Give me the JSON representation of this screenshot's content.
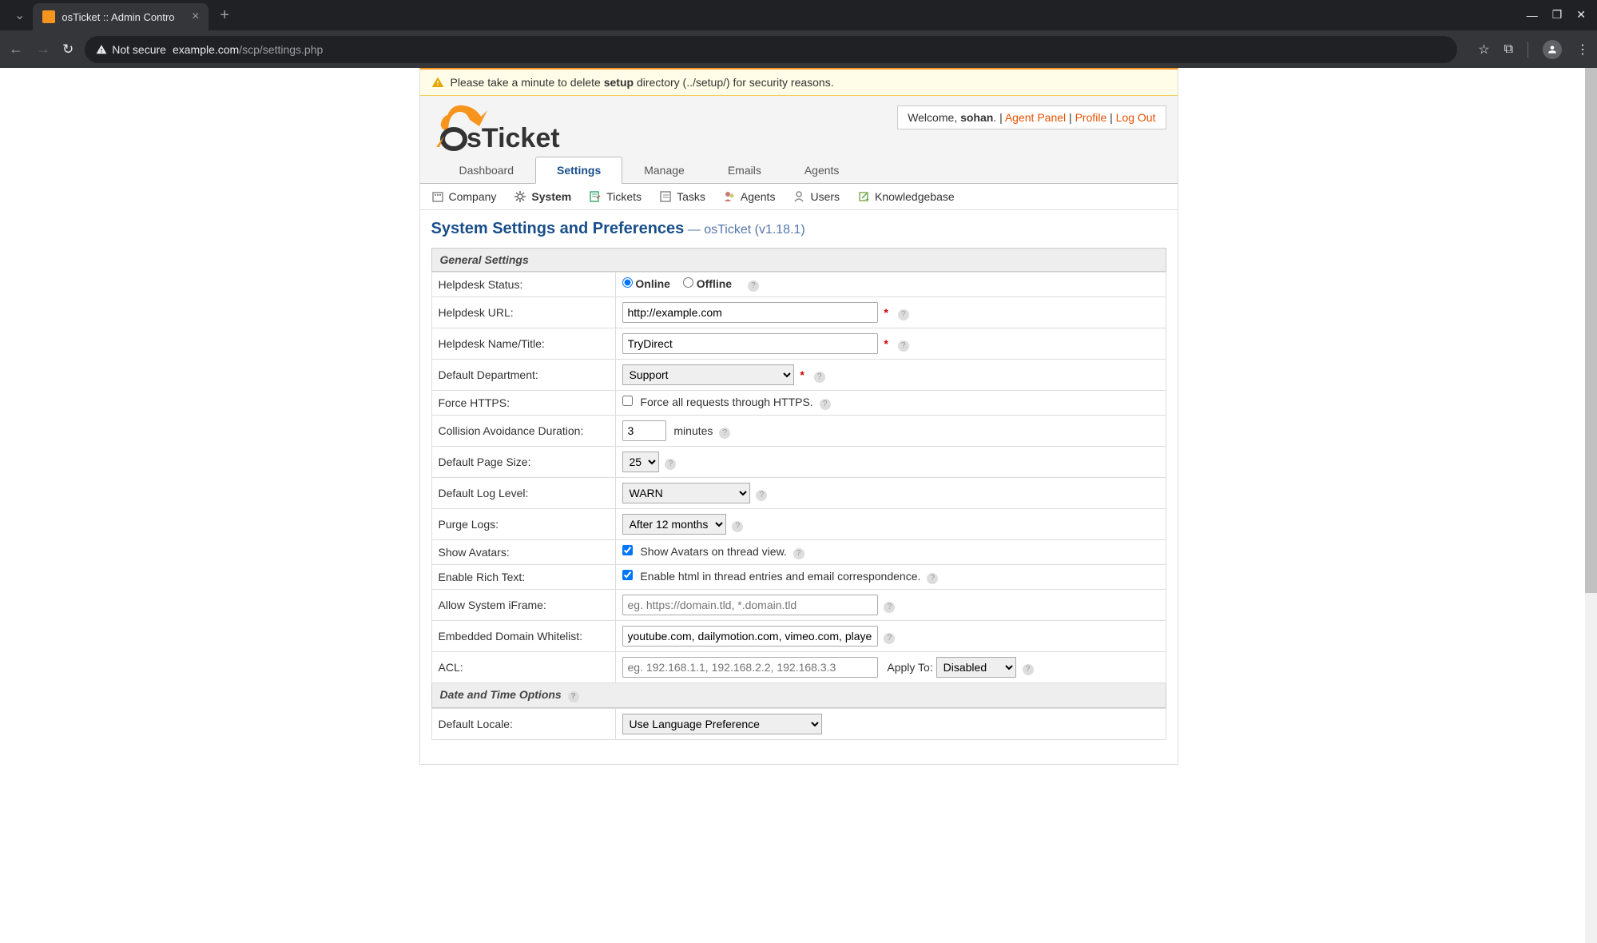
{
  "browser": {
    "tab_title": "osTicket :: Admin Contro",
    "not_secure": "Not secure",
    "url_domain": "example.com",
    "url_path": "/scp/settings.php"
  },
  "warning": {
    "prefix": "Please take a minute to delete ",
    "bold": "setup",
    "suffix": " directory (../setup/) for security reasons."
  },
  "userbox": {
    "welcome": "Welcome, ",
    "username": "sohan",
    "agent_panel": "Agent Panel",
    "profile": "Profile",
    "logout": "Log Out"
  },
  "main_tabs": [
    "Dashboard",
    "Settings",
    "Manage",
    "Emails",
    "Agents"
  ],
  "sub_tabs": [
    "Company",
    "System",
    "Tickets",
    "Tasks",
    "Agents",
    "Users",
    "Knowledgebase"
  ],
  "title": {
    "main": "System Settings and Preferences",
    "version": " — osTicket (v1.18.1)"
  },
  "sections": {
    "general": "General Settings",
    "datetime": "Date and Time Options"
  },
  "fields": {
    "helpdesk_status": {
      "label": "Helpdesk Status:",
      "online": "Online",
      "offline": "Offline"
    },
    "helpdesk_url": {
      "label": "Helpdesk URL:",
      "value": "http://example.com"
    },
    "helpdesk_name": {
      "label": "Helpdesk Name/Title:",
      "value": "TryDirect"
    },
    "default_dept": {
      "label": "Default Department:",
      "value": "Support"
    },
    "force_https": {
      "label": "Force HTTPS:",
      "text": "Force all requests through HTTPS."
    },
    "collision": {
      "label": "Collision Avoidance Duration:",
      "value": "3",
      "unit": "minutes"
    },
    "page_size": {
      "label": "Default Page Size:",
      "value": "25"
    },
    "log_level": {
      "label": "Default Log Level:",
      "value": "WARN"
    },
    "purge_logs": {
      "label": "Purge Logs:",
      "value": "After 12 months"
    },
    "avatars": {
      "label": "Show Avatars:",
      "text": "Show Avatars on thread view."
    },
    "richtext": {
      "label": "Enable Rich Text:",
      "text": "Enable html in thread entries and email correspondence."
    },
    "iframe": {
      "label": "Allow System iFrame:",
      "placeholder": "eg. https://domain.tld, *.domain.tld"
    },
    "embed": {
      "label": "Embedded Domain Whitelist:",
      "value": "youtube.com, dailymotion.com, vimeo.com, player.vim"
    },
    "acl": {
      "label": "ACL:",
      "placeholder": "eg. 192.168.1.1, 192.168.2.2, 192.168.3.3",
      "applyto_label": "Apply To:",
      "applyto_value": "Disabled"
    },
    "locale": {
      "label": "Default Locale:",
      "value": "Use Language Preference"
    }
  }
}
